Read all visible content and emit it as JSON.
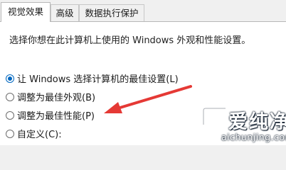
{
  "tabs": [
    {
      "label": "视觉效果",
      "active": true
    },
    {
      "label": "高级",
      "active": false
    },
    {
      "label": "数据执行保护",
      "active": false
    }
  ],
  "description": "选择你想在此计算机上使用的 Windows 外观和性能设置。",
  "options": [
    {
      "label": "让 Windows 选择计算机的最佳设置(L)",
      "checked": true
    },
    {
      "label": "调整为最佳外观(B)",
      "checked": false
    },
    {
      "label": "调整为最佳性能(P)",
      "checked": false
    },
    {
      "label": "自定义(C):",
      "checked": false
    }
  ],
  "watermark": {
    "text": "爱纯净",
    "url": "aichunjing.com"
  },
  "colors": {
    "accent": "#0067c0",
    "annotation_arrow": "#e53935"
  }
}
